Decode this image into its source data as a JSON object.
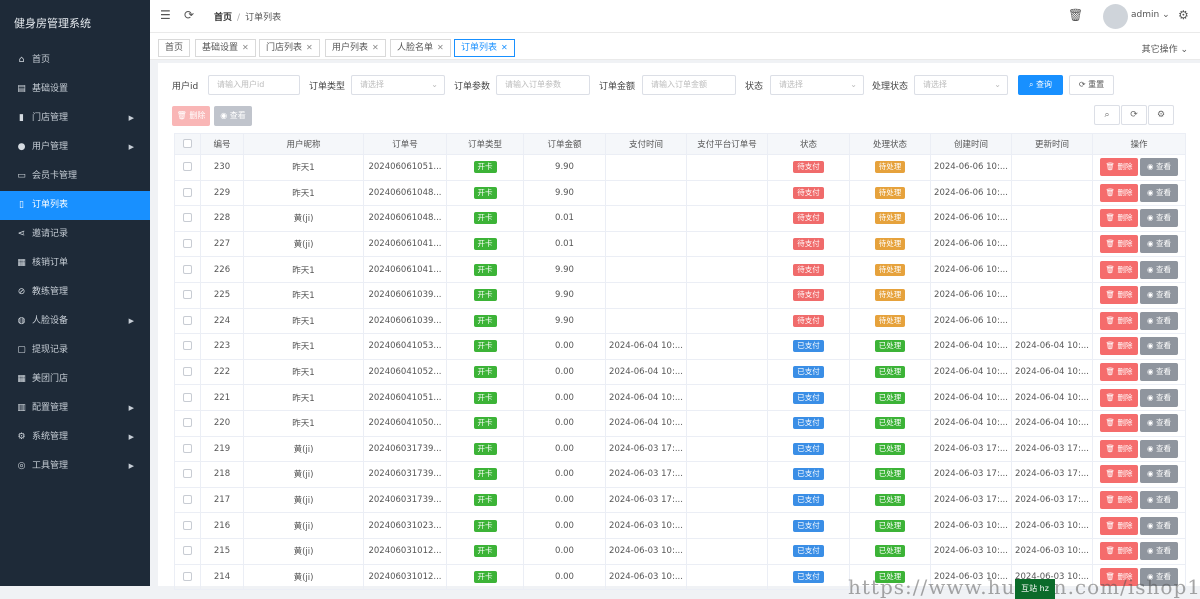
{
  "app": {
    "title": "健身房管理系统"
  },
  "sidebar": {
    "items": [
      {
        "label": "首页",
        "icon": "home-icon",
        "glyph": "⌂",
        "arrow": false,
        "active": false
      },
      {
        "label": "基础设置",
        "icon": "settings-doc-icon",
        "glyph": "▤",
        "arrow": false,
        "active": false
      },
      {
        "label": "门店管理",
        "icon": "store-icon",
        "glyph": "▮",
        "arrow": true,
        "active": false
      },
      {
        "label": "用户管理",
        "icon": "user-icon",
        "glyph": "●",
        "arrow": true,
        "active": false
      },
      {
        "label": "会员卡管理",
        "icon": "card-icon",
        "glyph": "▭",
        "arrow": false,
        "active": false
      },
      {
        "label": "订单列表",
        "icon": "order-list-icon",
        "glyph": "▯",
        "arrow": false,
        "active": true
      },
      {
        "label": "邀请记录",
        "icon": "share-icon",
        "glyph": "⋖",
        "arrow": false,
        "active": false
      },
      {
        "label": "核销订单",
        "icon": "grid-icon",
        "glyph": "▦",
        "arrow": false,
        "active": false
      },
      {
        "label": "教练管理",
        "icon": "compass-icon",
        "glyph": "⊘",
        "arrow": false,
        "active": false
      },
      {
        "label": "人脸设备",
        "icon": "users-icon",
        "glyph": "◍",
        "arrow": true,
        "active": false
      },
      {
        "label": "提现记录",
        "icon": "folder-icon",
        "glyph": "▢",
        "arrow": false,
        "active": false
      },
      {
        "label": "美团门店",
        "icon": "grid-small-icon",
        "glyph": "▦",
        "arrow": false,
        "active": false
      },
      {
        "label": "配置管理",
        "icon": "bar-chart-icon",
        "glyph": "▥",
        "arrow": true,
        "active": false
      },
      {
        "label": "系统管理",
        "icon": "gear-icon",
        "glyph": "⚙",
        "arrow": true,
        "active": false
      },
      {
        "label": "工具管理",
        "icon": "globe-icon",
        "glyph": "◎",
        "arrow": true,
        "active": false
      }
    ]
  },
  "header": {
    "breadcrumb_home": "首页",
    "breadcrumb_sep": "/",
    "breadcrumb_current": "订单列表",
    "username": "admin"
  },
  "tabs": [
    {
      "label": "首页",
      "closable": false,
      "active": false
    },
    {
      "label": "基础设置",
      "closable": true,
      "active": false
    },
    {
      "label": "门店列表",
      "closable": true,
      "active": false
    },
    {
      "label": "用户列表",
      "closable": true,
      "active": false
    },
    {
      "label": "人脸名单",
      "closable": true,
      "active": false
    },
    {
      "label": "订单列表",
      "closable": true,
      "active": true
    }
  ],
  "tabs_more": "其它操作",
  "filters": {
    "user_id_label": "用户id",
    "user_id_placeholder": "请输入用户id",
    "order_type_label": "订单类型",
    "order_type_placeholder": "请选择",
    "order_param_label": "订单参数",
    "order_param_placeholder": "请输入订单参数",
    "order_amount_label": "订单金额",
    "order_amount_placeholder": "请输入订单金额",
    "status_label": "状态",
    "status_placeholder": "请选择",
    "process_label": "处理状态",
    "process_placeholder": "请选择",
    "search_button": "查询",
    "reset_button": "重置"
  },
  "toolbar": {
    "delete_button": "删除",
    "view_button": "查看"
  },
  "table": {
    "columns": [
      "编号",
      "用户昵称",
      "订单号",
      "订单类型",
      "订单金额",
      "支付时间",
      "支付平台订单号",
      "状态",
      "处理状态",
      "创建时间",
      "更新时间",
      "操作"
    ],
    "row_delete": "删除",
    "row_view": "查看",
    "rows": [
      {
        "id": "230",
        "nick": "昨天1",
        "order_no": "202406061051...",
        "type": "开卡",
        "amount": "9.90",
        "paid_at": "",
        "platform_no": "",
        "status": "待支付",
        "status_color": "#f06b6b",
        "process": "待处理",
        "process_color": "#e6a23c",
        "created": "2024-06-06 10:...",
        "updated": ""
      },
      {
        "id": "229",
        "nick": "昨天1",
        "order_no": "202406061048...",
        "type": "开卡",
        "amount": "9.90",
        "paid_at": "",
        "platform_no": "",
        "status": "待支付",
        "status_color": "#f06b6b",
        "process": "待处理",
        "process_color": "#e6a23c",
        "created": "2024-06-06 10:...",
        "updated": ""
      },
      {
        "id": "228",
        "nick": "黄(ji)",
        "order_no": "202406061048...",
        "type": "开卡",
        "amount": "0.01",
        "paid_at": "",
        "platform_no": "",
        "status": "待支付",
        "status_color": "#f06b6b",
        "process": "待处理",
        "process_color": "#e6a23c",
        "created": "2024-06-06 10:...",
        "updated": ""
      },
      {
        "id": "227",
        "nick": "黄(ji)",
        "order_no": "202406061041...",
        "type": "开卡",
        "amount": "0.01",
        "paid_at": "",
        "platform_no": "",
        "status": "待支付",
        "status_color": "#f06b6b",
        "process": "待处理",
        "process_color": "#e6a23c",
        "created": "2024-06-06 10:...",
        "updated": ""
      },
      {
        "id": "226",
        "nick": "昨天1",
        "order_no": "202406061041...",
        "type": "开卡",
        "amount": "9.90",
        "paid_at": "",
        "platform_no": "",
        "status": "待支付",
        "status_color": "#f06b6b",
        "process": "待处理",
        "process_color": "#e6a23c",
        "created": "2024-06-06 10:...",
        "updated": ""
      },
      {
        "id": "225",
        "nick": "昨天1",
        "order_no": "202406061039...",
        "type": "开卡",
        "amount": "9.90",
        "paid_at": "",
        "platform_no": "",
        "status": "待支付",
        "status_color": "#f06b6b",
        "process": "待处理",
        "process_color": "#e6a23c",
        "created": "2024-06-06 10:...",
        "updated": ""
      },
      {
        "id": "224",
        "nick": "昨天1",
        "order_no": "202406061039...",
        "type": "开卡",
        "amount": "9.90",
        "paid_at": "",
        "platform_no": "",
        "status": "待支付",
        "status_color": "#f06b6b",
        "process": "待处理",
        "process_color": "#e6a23c",
        "created": "2024-06-06 10:...",
        "updated": ""
      },
      {
        "id": "223",
        "nick": "昨天1",
        "order_no": "202406041053...",
        "type": "开卡",
        "amount": "0.00",
        "paid_at": "2024-06-04 10:...",
        "platform_no": "",
        "status": "已支付",
        "status_color": "#3a8ee6",
        "process": "已处理",
        "process_color": "#3cb337",
        "created": "2024-06-04 10:...",
        "updated": "2024-06-04 10:..."
      },
      {
        "id": "222",
        "nick": "昨天1",
        "order_no": "202406041052...",
        "type": "开卡",
        "amount": "0.00",
        "paid_at": "2024-06-04 10:...",
        "platform_no": "",
        "status": "已支付",
        "status_color": "#3a8ee6",
        "process": "已处理",
        "process_color": "#3cb337",
        "created": "2024-06-04 10:...",
        "updated": "2024-06-04 10:..."
      },
      {
        "id": "221",
        "nick": "昨天1",
        "order_no": "202406041051...",
        "type": "开卡",
        "amount": "0.00",
        "paid_at": "2024-06-04 10:...",
        "platform_no": "",
        "status": "已支付",
        "status_color": "#3a8ee6",
        "process": "已处理",
        "process_color": "#3cb337",
        "created": "2024-06-04 10:...",
        "updated": "2024-06-04 10:..."
      },
      {
        "id": "220",
        "nick": "昨天1",
        "order_no": "202406041050...",
        "type": "开卡",
        "amount": "0.00",
        "paid_at": "2024-06-04 10:...",
        "platform_no": "",
        "status": "已支付",
        "status_color": "#3a8ee6",
        "process": "已处理",
        "process_color": "#3cb337",
        "created": "2024-06-04 10:...",
        "updated": "2024-06-04 10:..."
      },
      {
        "id": "219",
        "nick": "黄(ji)",
        "order_no": "202406031739...",
        "type": "开卡",
        "amount": "0.00",
        "paid_at": "2024-06-03 17:...",
        "platform_no": "",
        "status": "已支付",
        "status_color": "#3a8ee6",
        "process": "已处理",
        "process_color": "#3cb337",
        "created": "2024-06-03 17:...",
        "updated": "2024-06-03 17:..."
      },
      {
        "id": "218",
        "nick": "黄(ji)",
        "order_no": "202406031739...",
        "type": "开卡",
        "amount": "0.00",
        "paid_at": "2024-06-03 17:...",
        "platform_no": "",
        "status": "已支付",
        "status_color": "#3a8ee6",
        "process": "已处理",
        "process_color": "#3cb337",
        "created": "2024-06-03 17:...",
        "updated": "2024-06-03 17:..."
      },
      {
        "id": "217",
        "nick": "黄(ji)",
        "order_no": "202406031739...",
        "type": "开卡",
        "amount": "0.00",
        "paid_at": "2024-06-03 17:...",
        "platform_no": "",
        "status": "已支付",
        "status_color": "#3a8ee6",
        "process": "已处理",
        "process_color": "#3cb337",
        "created": "2024-06-03 17:...",
        "updated": "2024-06-03 17:..."
      },
      {
        "id": "216",
        "nick": "黄(ji)",
        "order_no": "202406031023...",
        "type": "开卡",
        "amount": "0.00",
        "paid_at": "2024-06-03 10:...",
        "platform_no": "",
        "status": "已支付",
        "status_color": "#3a8ee6",
        "process": "已处理",
        "process_color": "#3cb337",
        "created": "2024-06-03 10:...",
        "updated": "2024-06-03 10:..."
      },
      {
        "id": "215",
        "nick": "黄(ji)",
        "order_no": "202406031012...",
        "type": "开卡",
        "amount": "0.00",
        "paid_at": "2024-06-03 10:...",
        "platform_no": "",
        "status": "已支付",
        "status_color": "#3a8ee6",
        "process": "已处理",
        "process_color": "#3cb337",
        "created": "2024-06-03 10:...",
        "updated": "2024-06-03 10:..."
      },
      {
        "id": "214",
        "nick": "黄(ji)",
        "order_no": "202406031012...",
        "type": "开卡",
        "amount": "0.00",
        "paid_at": "2024-06-03 10:...",
        "platform_no": "",
        "status": "已支付",
        "status_color": "#3a8ee6",
        "process": "已处理",
        "process_color": "#3cb337",
        "created": "2024-06-03 10:...",
        "updated": "2024-06-03 10:..."
      }
    ]
  },
  "type_badge_color": "#3cb337",
  "watermark": {
    "text": "https://www.huzhan.com/ishop16558",
    "badge": "互站 hz"
  }
}
